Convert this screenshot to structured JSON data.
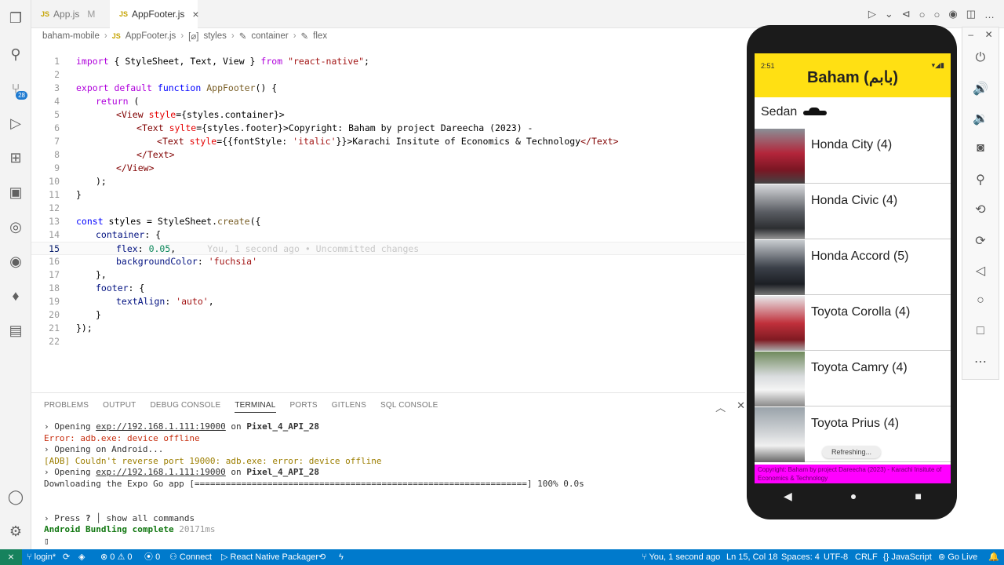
{
  "tabs": [
    {
      "label": "App.js",
      "modified": "M"
    },
    {
      "label": "AppFooter.js",
      "close": "×"
    }
  ],
  "breadcrumb": [
    "baham-mobile",
    "AppFooter.js",
    "styles",
    "container",
    "flex"
  ],
  "editor": {
    "lines": [
      "1",
      "2",
      "3",
      "4",
      "5",
      "6",
      "7",
      "8",
      "9",
      "10",
      "11",
      "12",
      "13",
      "14",
      "15",
      "16",
      "17",
      "18",
      "19",
      "20",
      "21",
      "22"
    ],
    "code": {
      "l1": [
        "import",
        " { StyleSheet, Text, View } ",
        "from",
        " ",
        "\"react-native\"",
        ";"
      ],
      "l3": [
        "export",
        " ",
        "default",
        " ",
        "function",
        " ",
        "AppFooter",
        "() {"
      ],
      "l4": [
        "return",
        " ("
      ],
      "l5": [
        "<",
        "View",
        " ",
        "style",
        "={styles.container}>"
      ],
      "l6": [
        "<",
        "Text",
        " ",
        "sylte",
        "={styles.footer}>",
        "Copyright: Baham by project Dareecha (2023) -"
      ],
      "l7": [
        "<",
        "Text",
        " ",
        "style",
        "={{fontStyle: ",
        "'italic'",
        "}}>",
        "Karachi Insitute of Economics & Technology",
        "</",
        "Text",
        ">"
      ],
      "l8": [
        "</",
        "Text",
        ">"
      ],
      "l9": [
        "</",
        "View",
        ">"
      ],
      "l10": [
        ");"
      ],
      "l11": [
        "}"
      ],
      "l13": [
        "const",
        " styles = StyleSheet.",
        "create",
        "({"
      ],
      "l14": [
        "container",
        ": {"
      ],
      "l15": [
        "flex",
        ": ",
        "0.05",
        ","
      ],
      "l15_blame": "You, 1 second ago • Uncommitted changes",
      "l16": [
        "backgroundColor",
        ": ",
        "'fuchsia'"
      ],
      "l17": [
        "},"
      ],
      "l18": [
        "footer",
        ": {"
      ],
      "l19": [
        "textAlign",
        ": ",
        "'auto'",
        ","
      ],
      "l20": [
        "}"
      ],
      "l21": [
        "});"
      ]
    }
  },
  "panel": {
    "tabs": [
      "PROBLEMS",
      "OUTPUT",
      "DEBUG CONSOLE",
      "TERMINAL",
      "PORTS",
      "GITLENS",
      "SQL CONSOLE"
    ],
    "terminal": {
      "t1": [
        "› Opening ",
        "exp://192.168.1.111:19000",
        " on ",
        "Pixel_4_API_28"
      ],
      "t2": "Error: adb.exe: device offline",
      "t3": "› Opening on Android...",
      "t4": "[ADB] Couldn't reverse port 19000: adb.exe: error: device offline",
      "t5": [
        "› Opening ",
        "exp://192.168.1.111:19000",
        " on ",
        "Pixel_4_API_28"
      ],
      "t6": "Downloading the Expo Go app [================================================================] 100% 0.0s",
      "t8": [
        "› Press ",
        "?",
        " │ show all commands"
      ],
      "t9": [
        "Android Bundling complete",
        " 20171ms"
      ]
    }
  },
  "phone": {
    "status_time": "2:51",
    "app_title": "Baham (بابم)",
    "section": "Sedan",
    "cars": [
      {
        "name": "Honda City (4)",
        "color": "#b3253a"
      },
      {
        "name": "Honda Civic (4)",
        "color": "#5a5d63"
      },
      {
        "name": "Honda Accord (5)",
        "color": "#3b4049"
      },
      {
        "name": "Toyota Corolla (4)",
        "color": "#c0303b"
      },
      {
        "name": "Toyota Camry (4)",
        "color": "#d9dcde"
      },
      {
        "name": "Toyota Prius (4)",
        "color": "#cfd2d5"
      }
    ],
    "refreshing": "Refreshing...",
    "footer": "Copyright: Baham by project Dareecha (2023) - Karachi Insitute of Economics & Technology"
  },
  "statusbar": {
    "branch": "login*",
    "problems": "⊗ 0 ⚠ 0",
    "ports": "0",
    "connect": "Connect",
    "packager": "React Native Packager",
    "blame": "You, 1 second ago",
    "position": "Ln 15, Col 18",
    "spaces": "Spaces: 4",
    "encoding": "UTF-8",
    "eol": "CRLF",
    "language": "JavaScript",
    "golive": "Go Live"
  },
  "colors": {
    "accent": "#007acc",
    "appbar": "#ffe013",
    "footer": "#ff00ff"
  }
}
